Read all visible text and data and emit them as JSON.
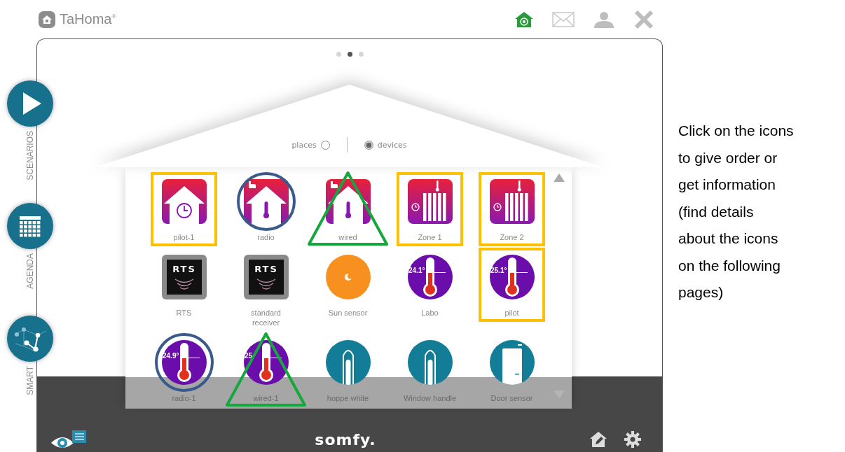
{
  "header": {
    "brand": "TaHoma$^{®}$"
  },
  "pager": [
    {
      "selected": false
    },
    {
      "selected": true
    },
    {
      "selected": false
    }
  ],
  "side_nav": [
    {
      "kind": "play",
      "label": "SCENARIOS"
    },
    {
      "kind": "calendar",
      "label": "AGENDA"
    },
    {
      "kind": "network",
      "label": "SMART"
    }
  ],
  "view_toggle": [
    {
      "label": "places",
      "selected": false
    },
    {
      "label": "devices",
      "selected": true
    }
  ],
  "devices": [
    {
      "label": "pilot-1",
      "kind": "house-clock",
      "boxed": true,
      "circled": false,
      "triangled": false
    },
    {
      "label": "radio",
      "kind": "house-thermo",
      "boxed": false,
      "circled": true,
      "triangled": false
    },
    {
      "label": "wired",
      "kind": "house-thermo",
      "boxed": false,
      "circled": false,
      "triangled": true
    },
    {
      "label": "Zone 1",
      "kind": "radiator",
      "boxed": true,
      "circled": false,
      "triangled": false
    },
    {
      "label": "Zone 2",
      "kind": "radiator",
      "boxed": true,
      "circled": false,
      "triangled": false
    },
    {
      "label": "RTS",
      "kind": "rts",
      "badge": "RTS",
      "boxed": false,
      "circled": false,
      "triangled": false
    },
    {
      "label": "standard receiver",
      "kind": "rts",
      "badge": "RTS",
      "boxed": false,
      "circled": false,
      "triangled": false
    },
    {
      "label": "Sun sensor",
      "kind": "sun",
      "boxed": false,
      "circled": false,
      "triangled": false
    },
    {
      "label": "Labo",
      "kind": "thermo",
      "reading": "24.1°",
      "boxed": false,
      "circled": false,
      "triangled": false
    },
    {
      "label": "pilot",
      "kind": "thermo",
      "reading": "25.1°",
      "boxed": true,
      "circled": false,
      "triangled": false
    },
    {
      "label": "radio-1",
      "kind": "thermo",
      "reading": "24.9°",
      "boxed": false,
      "circled": true,
      "triangled": false
    },
    {
      "label": "wired-1",
      "kind": "thermo",
      "reading": "25.",
      "boxed": false,
      "circled": false,
      "triangled": true
    },
    {
      "label": "hoppe white",
      "kind": "handle",
      "boxed": false,
      "circled": false,
      "triangled": false
    },
    {
      "label": "Window handle",
      "kind": "handle",
      "boxed": false,
      "circled": false,
      "triangled": false
    },
    {
      "label": "Door sensor",
      "kind": "door",
      "boxed": false,
      "circled": false,
      "triangled": false
    }
  ],
  "footer": {
    "logo": "somfy."
  },
  "note": "Click on the icons\nto give order or\nget information\n(find details\nabout the icons\non the following\npages)"
}
